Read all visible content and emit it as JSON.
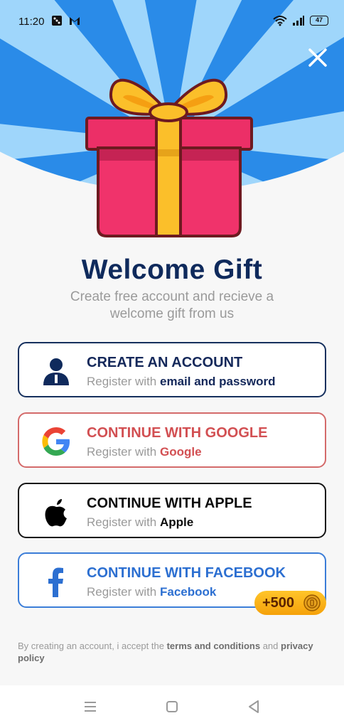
{
  "status_bar": {
    "time": "11:20",
    "battery": "47",
    "icons": [
      "dice-icon",
      "gmail-icon",
      "wifi-icon",
      "signal-icon",
      "battery-icon"
    ]
  },
  "header": {
    "title": "Welcome Gift",
    "subtitle": "Create free account and recieve a welcome gift from us"
  },
  "buttons": [
    {
      "title": "CREATE AN ACCOUNT",
      "prefix": "Register with",
      "strong": "email and password",
      "icon": "person-icon",
      "color": "#14285a"
    },
    {
      "title": "CONTINUE WITH GOOGLE",
      "prefix": "Register with",
      "strong": "Google",
      "icon": "google-icon",
      "color": "#d24f52"
    },
    {
      "title": "CONTINUE WITH APPLE",
      "prefix": "Register with",
      "strong": "Apple",
      "icon": "apple-icon",
      "color": "#0c0c0c"
    },
    {
      "title": "CONTINUE WITH FACEBOOK",
      "prefix": "Register with",
      "strong": "Facebook",
      "icon": "facebook-icon",
      "color": "#2c6fd1"
    }
  ],
  "reward_badge": {
    "amount": "+500",
    "icon": "coin-icon"
  },
  "terms": {
    "prefix": "By creating an account, i accept the",
    "link1": "terms and conditions",
    "middle": "and",
    "link2": "privacy policy"
  },
  "colors": {
    "title": "#0f2a5c",
    "ray_blue": "#2a8be8",
    "ray_light": "#9fd6fb",
    "gift_box": "#f0336b",
    "ribbon": "#fbbf2a"
  },
  "nav": [
    "menu-icon",
    "home-icon",
    "back-icon"
  ]
}
